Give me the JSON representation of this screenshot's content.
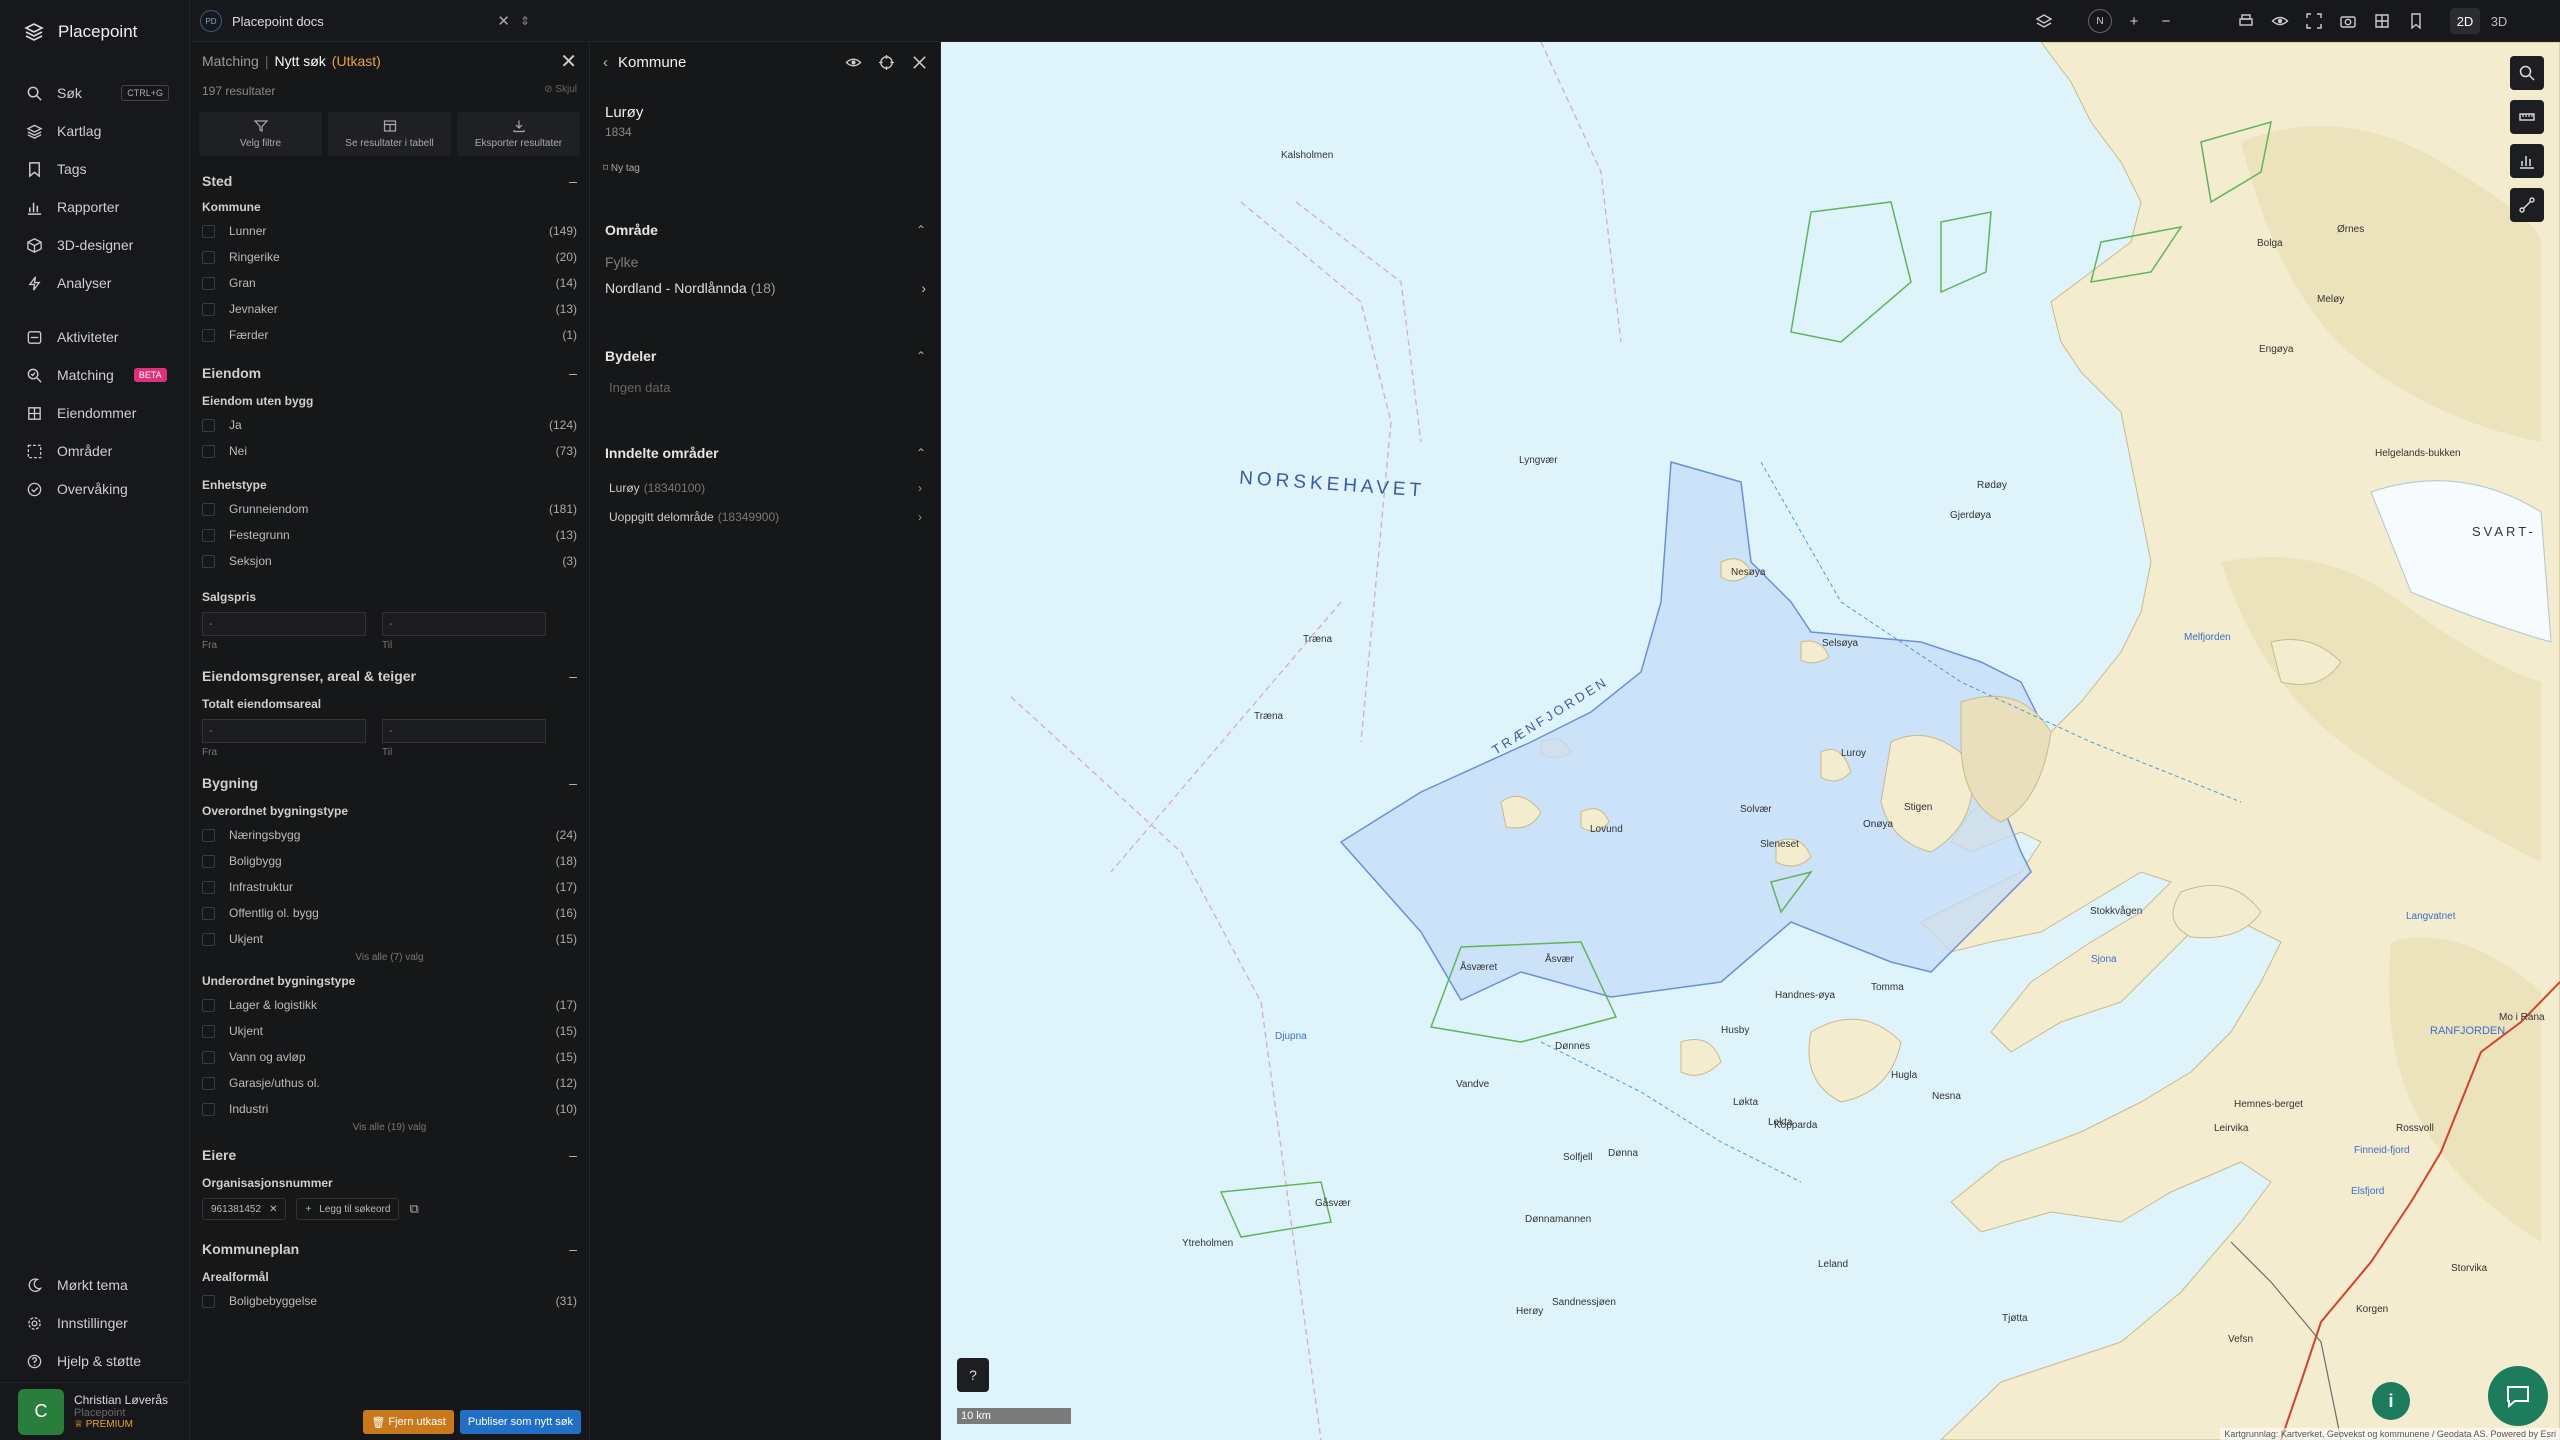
{
  "app": {
    "name": "Placepoint"
  },
  "nav": {
    "items": [
      {
        "label": "Søk",
        "shortcut": "CTRL+G"
      },
      {
        "label": "Kartlag"
      },
      {
        "label": "Tags"
      },
      {
        "label": "Rapporter"
      },
      {
        "label": "3D-designer"
      },
      {
        "label": "Analyser"
      },
      {
        "label": "Aktiviteter"
      },
      {
        "label": "Matching",
        "badge": "BETA"
      },
      {
        "label": "Eiendommer"
      },
      {
        "label": "Områder"
      },
      {
        "label": "Overvåking"
      }
    ],
    "bottom": [
      {
        "label": "Mørkt tema"
      },
      {
        "label": "Innstillinger"
      },
      {
        "label": "Hjelp & støtte"
      }
    ],
    "user": {
      "initial": "C",
      "name": "Christian Løverås",
      "org": "Placepoint",
      "plan": "PREMIUM"
    }
  },
  "topbar": {
    "project_badge": "PD",
    "project": "Placepoint docs",
    "compass": "N",
    "mode_2d": "2D",
    "mode_3d": "3D"
  },
  "search": {
    "crumb_root": "Matching",
    "crumb_sep": "|",
    "title": "Nytt søk",
    "draft": "(Utkast)",
    "count": "197 resultater",
    "hide": "Skjul",
    "actions": [
      "Velg filtre",
      "Se resultater i tabell",
      "Eksporter resultater"
    ],
    "sections": {
      "sted": {
        "title": "Sted",
        "sub": "Kommune",
        "items": [
          {
            "label": "Lunner",
            "count": "(149)"
          },
          {
            "label": "Ringerike",
            "count": "(20)"
          },
          {
            "label": "Gran",
            "count": "(14)"
          },
          {
            "label": "Jevnaker",
            "count": "(13)"
          },
          {
            "label": "Færder",
            "count": "(1)"
          }
        ]
      },
      "eiendom": {
        "title": "Eiendom",
        "sub1": "Eiendom uten bygg",
        "items1": [
          {
            "label": "Ja",
            "count": "(124)"
          },
          {
            "label": "Nei",
            "count": "(73)"
          }
        ],
        "sub2": "Enhetstype",
        "items2": [
          {
            "label": "Grunneiendom",
            "count": "(181)"
          },
          {
            "label": "Festegrunn",
            "count": "(13)"
          },
          {
            "label": "Seksjon",
            "count": "(3)"
          }
        ],
        "sub3": "Salgspris",
        "from": "Fra",
        "to": "Til",
        "ph": "-"
      },
      "grenser": {
        "title": "Eiendomsgrenser, areal & teiger",
        "sub": "Totalt eiendomsareal",
        "from": "Fra",
        "to": "Til",
        "ph": "-"
      },
      "bygning": {
        "title": "Bygning",
        "sub1": "Overordnet bygningstype",
        "items1": [
          {
            "label": "Næringsbygg",
            "count": "(24)"
          },
          {
            "label": "Boligbygg",
            "count": "(18)"
          },
          {
            "label": "Infrastruktur",
            "count": "(17)"
          },
          {
            "label": "Offentlig ol. bygg",
            "count": "(16)"
          },
          {
            "label": "Ukjent",
            "count": "(15)"
          }
        ],
        "showall1": "Vis alle (7) valg",
        "sub2": "Underordnet bygningstype",
        "items2": [
          {
            "label": "Lager & logistikk",
            "count": "(17)"
          },
          {
            "label": "Ukjent",
            "count": "(15)"
          },
          {
            "label": "Vann og avløp",
            "count": "(15)"
          },
          {
            "label": "Garasje/uthus ol.",
            "count": "(12)"
          },
          {
            "label": "Industri",
            "count": "(10)"
          }
        ],
        "showall2": "Vis alle (19) valg"
      },
      "eiere": {
        "title": "Eiere",
        "sub": "Organisasjonsnummer",
        "chip": "961381452",
        "add": "Legg til søkeord"
      },
      "kommuneplan": {
        "title": "Kommuneplan",
        "sub": "Arealformål",
        "item": {
          "label": "Boligbebyggelse",
          "count": "(31)"
        }
      }
    },
    "footer": {
      "remove": "Fjern utkast",
      "publish": "Publiser som nytt søk"
    }
  },
  "kommune": {
    "title": "Kommune",
    "name": "Lurøy",
    "number": "1834",
    "tag": "Ny tag",
    "omrade": {
      "title": "Område",
      "label": "Fylke",
      "value": "Nordland - Nordlånnda",
      "count": "(18)"
    },
    "bydeler": {
      "title": "Bydeler",
      "empty": "Ingen data"
    },
    "inndelte": {
      "title": "Inndelte områder",
      "items": [
        {
          "label": "Lurøy",
          "code": "(18340100)"
        },
        {
          "label": "Uoppgitt delområde",
          "code": "(18349900)"
        }
      ]
    }
  },
  "map": {
    "sea_label": "NORSKEHAVET",
    "fjord_labels": [
      "TRÆNFJORDEN",
      "SVART-"
    ],
    "place_labels": [
      "Kalsholmen",
      "Lyngvær",
      "Træna",
      "Træna",
      "Nesøya",
      "Selsøya",
      "Lovund",
      "Solvær",
      "Sleneset",
      "Åsvær",
      "Åsværet",
      "Djupna",
      "Vandve",
      "Dønnes",
      "Gåsvær",
      "Ytreholmen",
      "Sandnessjøen",
      "Dønnamannen",
      "Luroy",
      "Onøya",
      "Stigen",
      "Rødøy",
      "Gjerdøya",
      "Ørnes",
      "Bolga",
      "Meløy",
      "Engøya",
      "Helgelands-bukken",
      "Hemnes-berget",
      "Mo i Rana",
      "RANFJORDEN",
      "Melfjorden",
      "Sjona",
      "Langvatnet",
      "Stokkvågen",
      "Korgen",
      "Leirvika",
      "Rossvoll",
      "Finneid-fjord",
      "Elsfjord",
      "Vefsn",
      "Herøy",
      "Lekta",
      "Nesna",
      "Hugla",
      "Tomma",
      "Handnes-øya",
      "Husby",
      "Løkta",
      "Kopparda",
      "Dønna",
      "Solfjell",
      "Leland",
      "Tjøtta",
      "Storvika"
    ],
    "scale": "10 km",
    "attribution": "Kartgrunnlag: Kartverket, Geovekst og kommunene / Geodata AS. Powered by Esri"
  },
  "colors": {
    "accent_orange": "#e9a23b",
    "publish_blue": "#2170c4",
    "selection_fill": "#c5dcf7",
    "land": "#f3eccf",
    "sea": "#dff4fa",
    "badge_pink": "#e0307a",
    "green": "#1c7c5b"
  }
}
